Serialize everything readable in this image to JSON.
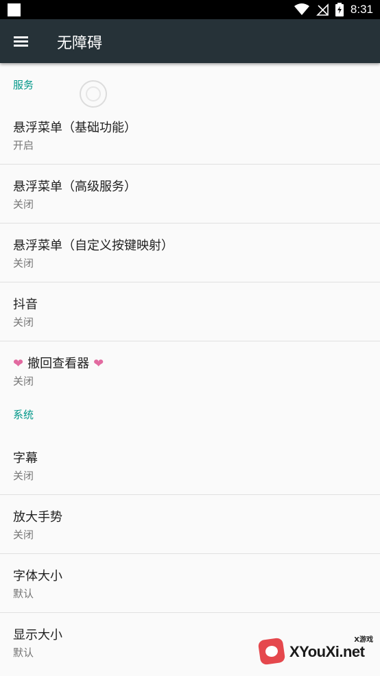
{
  "status_bar": {
    "time": "8:31",
    "icons": [
      "notification-square-icon",
      "wifi-icon",
      "no-signal-icon",
      "battery-charging-icon"
    ]
  },
  "app_bar": {
    "title": "无障碍",
    "menu_icon": "hamburger-menu-icon"
  },
  "sections": [
    {
      "header": "服务",
      "items": [
        {
          "title": "悬浮菜单（基础功能）",
          "summary": "开启"
        },
        {
          "title": "悬浮菜单（高级服务）",
          "summary": "关闭"
        },
        {
          "title": "悬浮菜单（自定义按键映射）",
          "summary": "关闭"
        },
        {
          "title": "抖音",
          "summary": "关闭"
        },
        {
          "title": "撤回查看器",
          "summary": "关闭",
          "decorations": "heart"
        }
      ]
    },
    {
      "header": "系统",
      "items": [
        {
          "title": "字幕",
          "summary": "关闭"
        },
        {
          "title": "放大手势",
          "summary": "关闭"
        },
        {
          "title": "字体大小",
          "summary": "默认"
        },
        {
          "title": "显示大小",
          "summary": "默认"
        }
      ]
    }
  ],
  "watermark": {
    "text": "XYouXi.net",
    "small_text": "X游戏"
  },
  "colors": {
    "app_bar": "#263238",
    "accent": "#009688",
    "heart": "#e26aa0",
    "background": "#fafafa"
  }
}
